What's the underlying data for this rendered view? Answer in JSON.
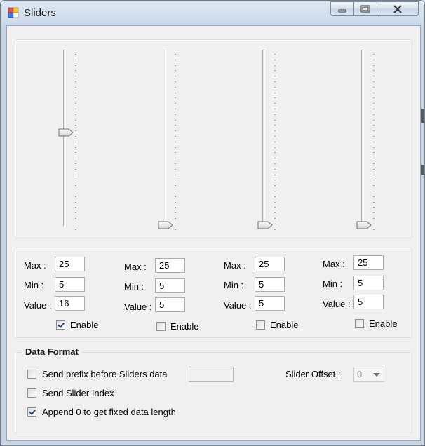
{
  "window": {
    "title": "Sliders",
    "minimize_icon": "minimize-icon",
    "maximize_icon": "maximize-icon",
    "close_icon": "close-icon"
  },
  "sliders": [
    {
      "max": "25",
      "min": "5",
      "value": "16",
      "enabled": true,
      "level_fraction": 0.55
    },
    {
      "max": "25",
      "min": "5",
      "value": "5",
      "enabled": false,
      "level_fraction": 0.0
    },
    {
      "max": "25",
      "min": "5",
      "value": "5",
      "enabled": false,
      "level_fraction": 0.0
    },
    {
      "max": "25",
      "min": "5",
      "value": "5",
      "enabled": false,
      "level_fraction": 0.0
    }
  ],
  "labels": {
    "max": "Max :",
    "min": "Min :",
    "value": "Value :",
    "enable": "Enable"
  },
  "data_format": {
    "title": "Data Format",
    "send_prefix_label": "Send prefix before Sliders data",
    "send_prefix_checked": false,
    "prefix_value": "",
    "send_index_label": "Send Slider Index",
    "send_index_checked": false,
    "append_zero_label": "Append 0 to get fixed data length",
    "append_zero_checked": true,
    "slider_offset_label": "Slider Offset :",
    "slider_offset_value": "0"
  }
}
